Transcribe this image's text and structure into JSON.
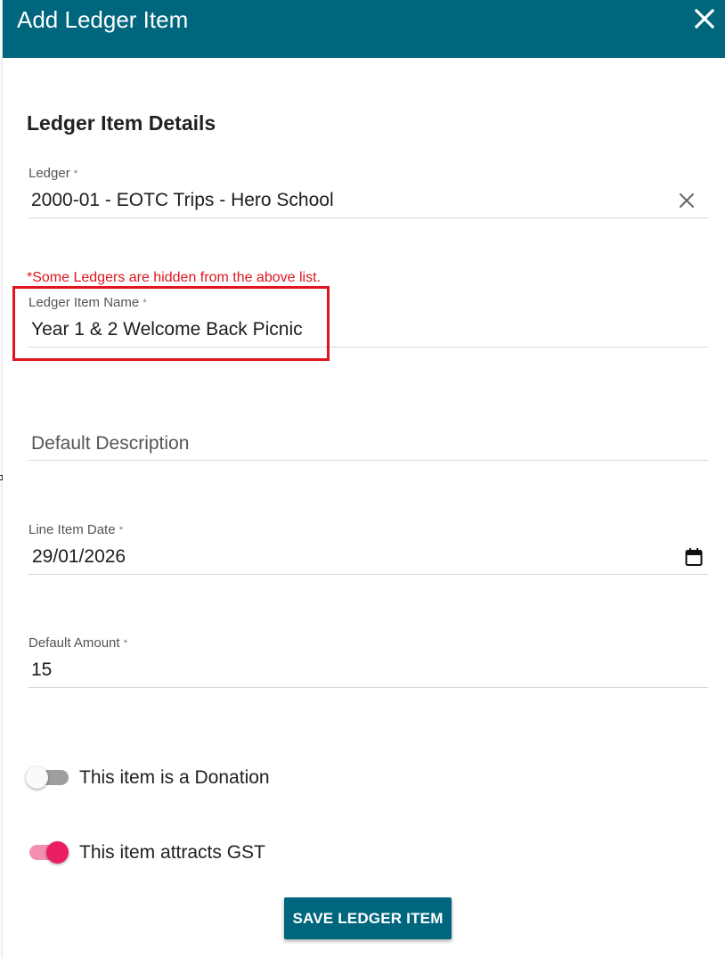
{
  "dialog": {
    "title": "Add Ledger Item",
    "close_icon": "close-icon"
  },
  "section": {
    "title": "Ledger Item Details"
  },
  "fields": {
    "ledger": {
      "label": "Ledger",
      "required_mark": "*",
      "value": "2000-01 - EOTC Trips - Hero School",
      "clear_icon": "clear-icon"
    },
    "hint": "*Some Ledgers are hidden from the above list.",
    "item_name": {
      "label": "Ledger Item Name",
      "required_mark": "*",
      "value": "Year 1 & 2 Welcome Back Picnic"
    },
    "description": {
      "placeholder": "Default Description",
      "value": ""
    },
    "date": {
      "label": "Line Item Date",
      "required_mark": "*",
      "value": "29/01/2026",
      "calendar_icon": "calendar-icon"
    },
    "amount": {
      "label": "Default Amount",
      "required_mark": "*",
      "value": "15"
    }
  },
  "toggles": {
    "donation": {
      "label": "This item is a Donation",
      "checked": false
    },
    "gst": {
      "label": "This item attracts GST",
      "checked": true
    }
  },
  "actions": {
    "save_label": "SAVE LEDGER ITEM"
  },
  "colors": {
    "header": "#00667e",
    "button": "#00667e",
    "hint": "#e0141e",
    "highlight": "#e0141e",
    "toggle_on": "#e91e63",
    "toggle_on_track": "#f48fb1",
    "toggle_off_track": "#9e9e9e"
  }
}
